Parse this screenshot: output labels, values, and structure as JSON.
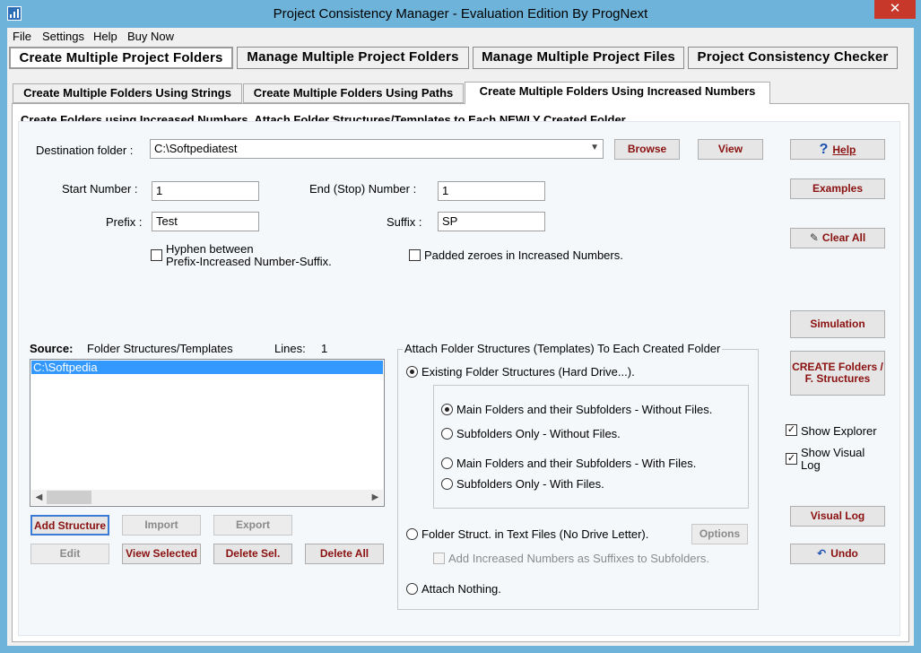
{
  "window": {
    "title": "Project Consistency Manager - Evaluation Edition  By ProgNext",
    "close": "✕"
  },
  "menu": [
    "File",
    "Settings",
    "Help",
    "Buy Now"
  ],
  "main_tabs": [
    "Create Multiple Project Folders",
    "Manage Multiple Project Folders",
    "Manage Multiple Project Files",
    "Project Consistency Checker"
  ],
  "sub_tabs": [
    "Create Multiple Folders Using Strings",
    "Create Multiple Folders Using Paths",
    "Create Multiple Folders Using Increased Numbers"
  ],
  "header": "Create Folders using Increased Numbers. Attach Folder Structures/Templates to Each NEWLY Created Folder.",
  "destination": {
    "label": "Destination folder :",
    "value": "C:\\Softpediatest",
    "browse": "Browse",
    "view": "View"
  },
  "numbers": {
    "start_label": "Start Number :",
    "start_value": "1",
    "end_label": "End (Stop) Number :",
    "end_value": "1",
    "prefix_label": "Prefix :",
    "prefix_value": "Test",
    "suffix_label": "Suffix :",
    "suffix_value": "SP"
  },
  "options": {
    "hyphen_line1": "Hyphen between",
    "hyphen_line2": "Prefix-Increased Number-Suffix.",
    "padded": "Padded zeroes in Increased Numbers."
  },
  "right_buttons": {
    "help": "Help",
    "examples": "Examples",
    "clear_all": "Clear All",
    "simulation": "Simulation",
    "create_line1": "CREATE Folders /",
    "create_line2": "F. Structures",
    "visual_log": "Visual Log",
    "undo": "Undo"
  },
  "right_checks": {
    "show_explorer": "Show Explorer",
    "show_visual_line1": "Show Visual",
    "show_visual_line2": "Log"
  },
  "source": {
    "label": "Source:",
    "type": "Folder Structures/Templates",
    "lines_label": "Lines:",
    "lines_value": "1",
    "items": [
      "C:\\Softpedia"
    ]
  },
  "source_buttons": {
    "add": "Add Structure",
    "import": "Import",
    "export": "Export",
    "edit": "Edit",
    "view_selected": "View Selected",
    "delete_sel": "Delete Sel.",
    "delete_all": "Delete All"
  },
  "attach": {
    "title": "Attach Folder Structures (Templates) To Each Created Folder",
    "existing": "Existing Folder Structures (Hard Drive...).",
    "main_no_files": "Main Folders and their Subfolders - Without Files.",
    "sub_no_files": "Subfolders Only - Without Files.",
    "main_files": "Main Folders and their Subfolders - With Files.",
    "sub_files": "Subfolders Only - With Files.",
    "text_files": "Folder Struct. in Text Files (No Drive Letter).",
    "options_btn": "Options",
    "add_suffix": "Add Increased Numbers as Suffixes to Subfolders.",
    "nothing": "Attach Nothing."
  },
  "colors": {
    "titlebar": "#6eb4da",
    "close": "#c7382b",
    "button_text": "#8b1010",
    "selection": "#3399ff"
  }
}
